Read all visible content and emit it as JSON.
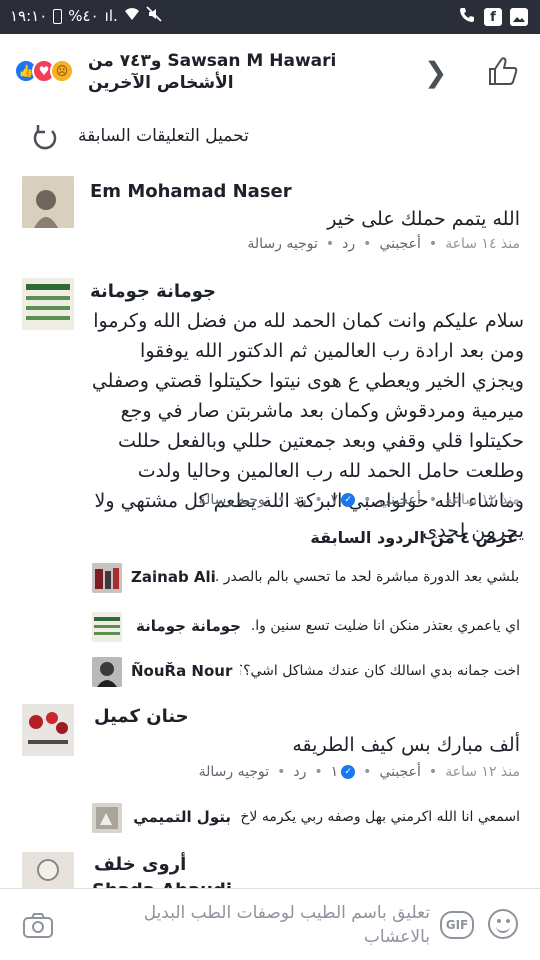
{
  "status_bar": {
    "time": "١٩:١٠",
    "battery": "%٤٠",
    "signal": "ıl.",
    "icons": [
      "phone-icon",
      "facebook-icon",
      "gallery-icon"
    ]
  },
  "header": {
    "reactions_text": "Sawsan M Hawari و٧٤٣ من الأشخاص الآخرين",
    "reactions": [
      "like",
      "love",
      "sad"
    ]
  },
  "load_previous": {
    "label": "تحميل التعليقات السابقة"
  },
  "comments": [
    {
      "author": "Em Mohamad Naser",
      "text": "الله يتمم حملك على خير",
      "time": "منذ ١٤ ساعة",
      "like": "أعجبني",
      "reply": "رد",
      "message": "توجيه رسالة"
    },
    {
      "author": "جومانة جومانة",
      "text": "سلام عليكم وانت كمان الحمد لله من فضل الله وكرموا ومن بعد ارادة رب العالمين ثم الدكتور الله يوفقوا ويجزي الخير ويعطي ع هوى نيتوا حكيتلوا قصتي وصفلي ميرمية ومردقوش وكمان بعد ماشربتن صار في وجع حكيتلوا قلي وقفي وبعد جمعتين حللي وبالفعل حللت وطلعت حامل الحمد لله رب العالمين وحاليا ولدت وماشاء الله حولواصبي البركة الله يطعم كل مشتهي ولا يحرمن لحدى",
      "time": "منذ ١٢ ساعة",
      "like": "أعجبني",
      "reply": "رد",
      "reactions_count": "٧",
      "message": "توجيه رسالة"
    },
    {
      "author": "حنان كميل",
      "text": "ألف مبارك بس كيف الطريقه",
      "time": "منذ ١٢ ساعة",
      "like": "أعجبني",
      "reply": "رد",
      "reactions_count": "١",
      "message": "توجيه رسالة"
    },
    {
      "author": "أروى خلف",
      "time": ""
    }
  ],
  "replies_toggle": {
    "label": "عرض ٤ من الردود السابقة"
  },
  "replies": [
    {
      "author": "Zainab Ali",
      "text": "بلشي بعد الدورة مباشرة لحد ما تحسي بالم بالصدر ..."
    },
    {
      "author": "جومانة جومانة",
      "text": "اي ياعمري بعتذر منكن انا ضليت تسع سنين وا..."
    },
    {
      "author": "ÑouŘa Nour",
      "text": "اخت جمانه بدي اسالك كان عندك مشاكل اشي؟؟..."
    },
    {
      "author": "بتول التميمي",
      "text": "اسمعي انا الله اكرمني بهل وصفه ربي يكرمه لاخ ن..."
    }
  ],
  "partial_reply": {
    "author": "Shada Abaudi"
  },
  "composer": {
    "placeholder": "تعليق باسم الطيب لوصفات الطب البديل بالاعشاب",
    "gif_label": "GIF"
  }
}
